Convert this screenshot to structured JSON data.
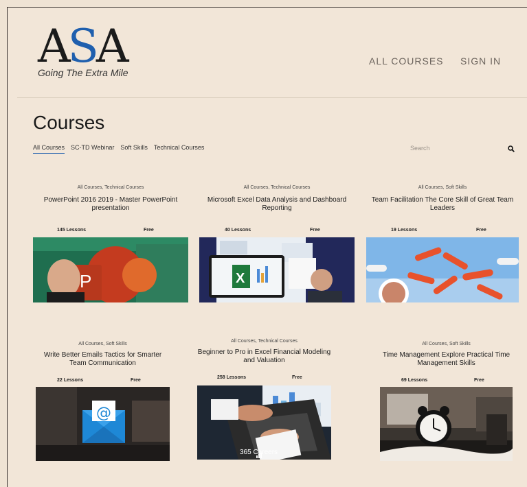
{
  "brand": {
    "logo_text": "ASA",
    "tagline": "Going The Extra Mile",
    "accent": "#1f5fae"
  },
  "nav": {
    "all_courses": "ALL COURSES",
    "sign_in": "SIGN IN"
  },
  "page": {
    "title": "Courses"
  },
  "filters": {
    "tabs": [
      {
        "label": "All Courses",
        "active": true
      },
      {
        "label": "SC-TD Webinar",
        "active": false
      },
      {
        "label": "Soft Skills",
        "active": false
      },
      {
        "label": "Technical Courses",
        "active": false
      }
    ]
  },
  "search": {
    "placeholder": "Search",
    "icon": "search-icon"
  },
  "courses": [
    {
      "categories": "All Courses, Technical Courses",
      "title": "PowerPoint 2016 2019 - Master PowerPoint presentation",
      "lessons": "145 Lessons",
      "price": "Free",
      "thumb": "powerpoint"
    },
    {
      "categories": "All Courses, Technical Courses",
      "title": "Microsoft Excel Data Analysis and Dashboard Reporting",
      "lessons": "40 Lessons",
      "price": "Free",
      "thumb": "excel"
    },
    {
      "categories": "All Courses, Soft Skills",
      "title": "Team Facilitation The Core Skill of Great Team Leaders",
      "lessons": "19 Lessons",
      "price": "Free",
      "thumb": "hands"
    },
    {
      "categories": "All Courses, Soft Skills",
      "title": "Write Better Emails Tactics for Smarter Team Communication",
      "lessons": "22 Lessons",
      "price": "Free",
      "thumb": "email"
    },
    {
      "categories": "All Courses, Technical Courses",
      "title": "Beginner to Pro in Excel Financial Modeling and Valuation",
      "lessons": "258 Lessons",
      "price": "Free",
      "thumb": "laptop",
      "thumb_caption": "365 Careers"
    },
    {
      "categories": "All Courses, Soft Skills",
      "title": "Time Management Explore Practical Time Management Skills",
      "lessons": "69 Lessons",
      "price": "Free",
      "thumb": "clock"
    }
  ]
}
